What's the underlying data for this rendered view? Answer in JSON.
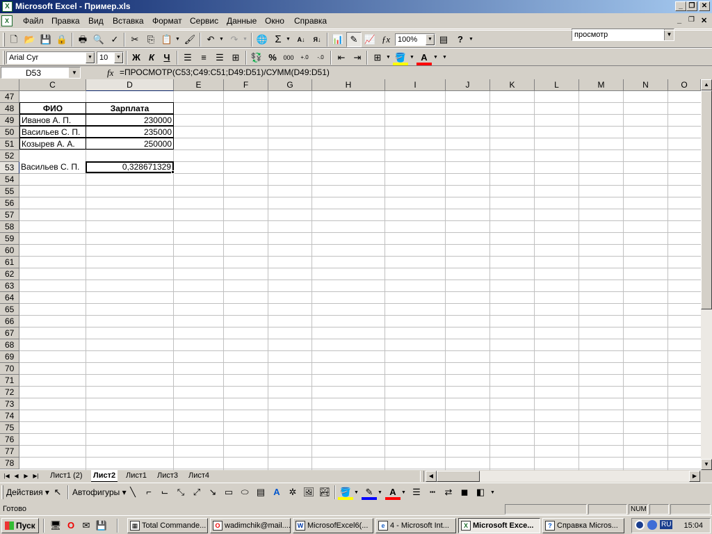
{
  "window": {
    "title": "Microsoft Excel - Пример.xls"
  },
  "menu": {
    "items": [
      "Файл",
      "Правка",
      "Вид",
      "Вставка",
      "Формат",
      "Сервис",
      "Данные",
      "Окно",
      "Справка"
    ]
  },
  "help_box": {
    "value": "просмотр"
  },
  "toolbar": {
    "zoom": "100%"
  },
  "format_toolbar": {
    "font": "Arial Cyr",
    "size": "10",
    "bold": "Ж",
    "italic": "К",
    "underline": "Ч",
    "percent": "%",
    "thousands": "000"
  },
  "formula_bar": {
    "name_box": "D53",
    "fx": "fx",
    "formula": "=ПРОСМОТР(C53;C49:C51;D49:D51)/СУММ(D49:D51)"
  },
  "columns": [
    "C",
    "D",
    "E",
    "F",
    "G",
    "H",
    "I",
    "J",
    "K",
    "L",
    "M",
    "N",
    "O"
  ],
  "rows": [
    "47",
    "48",
    "49",
    "50",
    "51",
    "52",
    "53",
    "54",
    "55",
    "56",
    "57",
    "58",
    "59",
    "60",
    "61",
    "62",
    "63",
    "64",
    "65",
    "66",
    "67",
    "68",
    "69",
    "70",
    "71",
    "72",
    "73",
    "74",
    "75",
    "76",
    "77",
    "78"
  ],
  "cells": {
    "c48": "ФИО",
    "d48": "Зарплата",
    "c49": "Иванов А. П.",
    "d49": "230000",
    "c50": "Васильев С. П.",
    "d50": "235000",
    "c51": "Козырев А. А.",
    "d51": "250000",
    "c53": "Васильев С. П.",
    "d53": "0,328671329"
  },
  "sheet_tabs": [
    "Лист1 (2)",
    "Лист2",
    "Лист1",
    "Лист3",
    "Лист4"
  ],
  "active_sheet": "Лист2",
  "drawing_toolbar": {
    "actions": "Действия",
    "autoshapes": "Автофигуры"
  },
  "status": {
    "text": "Готово",
    "num": "NUM"
  },
  "taskbar": {
    "start": "Пуск",
    "tasks": [
      "Total Commande...",
      "wadimchik@mail....",
      "MicrosofExcel6(...",
      "4 - Microsoft Int...",
      "Microsoft Exce...",
      "Справка Micros..."
    ],
    "lang": "RU",
    "clock": "15:04"
  }
}
